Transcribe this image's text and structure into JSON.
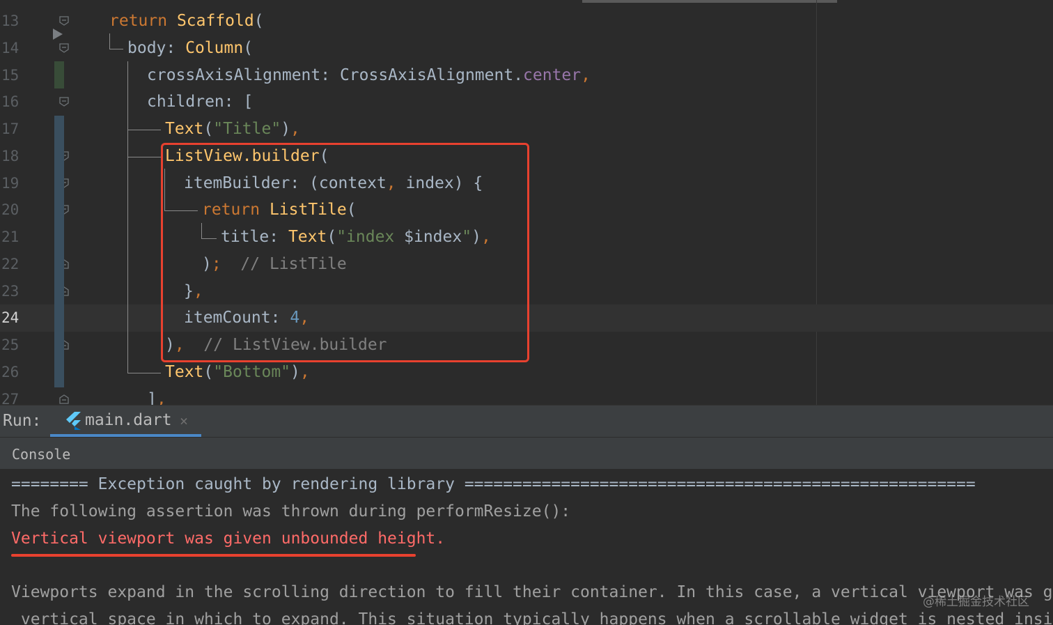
{
  "editor": {
    "lines": [
      {
        "num": "13",
        "parts": [
          [
            "kw",
            "return "
          ],
          [
            "fn",
            "Scaffold"
          ],
          [
            "",
            "("
          ]
        ]
      },
      {
        "num": "14",
        "parts": [
          [
            "",
            "body: "
          ],
          [
            "fn",
            "Column"
          ],
          [
            "",
            "("
          ]
        ]
      },
      {
        "num": "15",
        "parts": [
          [
            "",
            "crossAxisAlignment: CrossAxisAlignment."
          ],
          [
            "prop",
            "center"
          ],
          [
            "punc",
            ","
          ]
        ]
      },
      {
        "num": "16",
        "parts": [
          [
            "",
            "children: ["
          ]
        ]
      },
      {
        "num": "17",
        "parts": [
          [
            "fn",
            "Text"
          ],
          [
            "",
            "("
          ],
          [
            "str",
            "\"Title\""
          ],
          [
            "",
            ")"
          ],
          [
            "punc",
            ","
          ]
        ]
      },
      {
        "num": "18",
        "parts": [
          [
            "fn",
            "ListView.builder"
          ],
          [
            "",
            "("
          ]
        ]
      },
      {
        "num": "19",
        "parts": [
          [
            "",
            "itemBuilder: (context"
          ],
          [
            "punc",
            ","
          ],
          [
            "",
            " index) {"
          ]
        ]
      },
      {
        "num": "20",
        "parts": [
          [
            "kw",
            "return "
          ],
          [
            "fn",
            "ListTile"
          ],
          [
            "",
            "("
          ]
        ]
      },
      {
        "num": "21",
        "parts": [
          [
            "",
            "title: "
          ],
          [
            "fn",
            "Text"
          ],
          [
            "",
            "("
          ],
          [
            "str",
            "\"index "
          ],
          [
            "",
            "$index"
          ],
          [
            "str",
            "\""
          ],
          [
            "",
            ")"
          ],
          [
            "punc",
            ","
          ]
        ]
      },
      {
        "num": "22",
        "parts": [
          [
            "",
            ")"
          ],
          [
            "punc",
            ";"
          ],
          [
            "cmt",
            "  // ListTile"
          ]
        ]
      },
      {
        "num": "23",
        "parts": [
          [
            "",
            "}"
          ],
          [
            "punc",
            ","
          ]
        ]
      },
      {
        "num": "24",
        "parts": [
          [
            "",
            "itemCount: "
          ],
          [
            "num",
            "4"
          ],
          [
            "punc",
            ","
          ]
        ]
      },
      {
        "num": "25",
        "parts": [
          [
            "",
            ")"
          ],
          [
            "punc",
            ","
          ],
          [
            "cmt",
            "  // ListView.builder"
          ]
        ]
      },
      {
        "num": "26",
        "parts": [
          [
            "fn",
            "Text"
          ],
          [
            "",
            "("
          ],
          [
            "str",
            "\"Bottom\""
          ],
          [
            "",
            ")"
          ],
          [
            "punc",
            ","
          ]
        ]
      },
      {
        "num": "27",
        "parts": [
          [
            "",
            "]"
          ],
          [
            "punc",
            ","
          ]
        ]
      }
    ]
  },
  "run_bar": {
    "label": "Run:",
    "tab_name": "main.dart",
    "close_glyph": "×",
    "tab_icon": "flutter-icon"
  },
  "console": {
    "header": "Console",
    "lines": [
      "======== Exception caught by rendering library =====================================================",
      "The following assertion was thrown during performResize():",
      "Vertical viewport was given unbounded height.",
      "",
      "Viewports expand in the scrolling direction to fill their container. In this case, a vertical viewport was given",
      " vertical space in which to expand. This situation typically happens when a scrollable widget is nested inside an"
    ],
    "watermark": "@稀土掘金技术社区"
  },
  "colors": {
    "accent_highlight": "#e8412f",
    "tab_underline": "#4a88c7",
    "error_text": "#ff6b68"
  }
}
